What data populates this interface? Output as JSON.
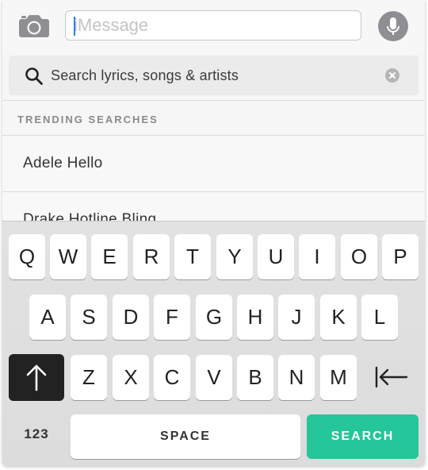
{
  "imessage": {
    "placeholder": "iMessage",
    "camera_icon": "camera-icon",
    "mic_icon": "microphone-icon"
  },
  "search": {
    "placeholder": "Search lyrics, songs & artists",
    "search_icon": "search-icon",
    "clear_icon": "clear-icon"
  },
  "trending": {
    "header": "TRENDING SEARCHES",
    "items": [
      {
        "label": "Adele Hello"
      },
      {
        "label": "Drake Hotline Bling"
      }
    ]
  },
  "keyboard": {
    "row1": [
      "Q",
      "W",
      "E",
      "R",
      "T",
      "Y",
      "U",
      "I",
      "O",
      "P"
    ],
    "row2": [
      "A",
      "S",
      "D",
      "F",
      "G",
      "H",
      "J",
      "K",
      "L"
    ],
    "row3": [
      "Z",
      "X",
      "C",
      "V",
      "B",
      "N",
      "M"
    ],
    "shift_icon": "shift-arrow-up-icon",
    "backspace_icon": "backspace-icon",
    "numbers_label": "123",
    "space_label": "SPACE",
    "search_label": "SEARCH"
  },
  "colors": {
    "accent": "#25c699",
    "shift_active": "#222222",
    "caret": "#2f7cf6"
  }
}
